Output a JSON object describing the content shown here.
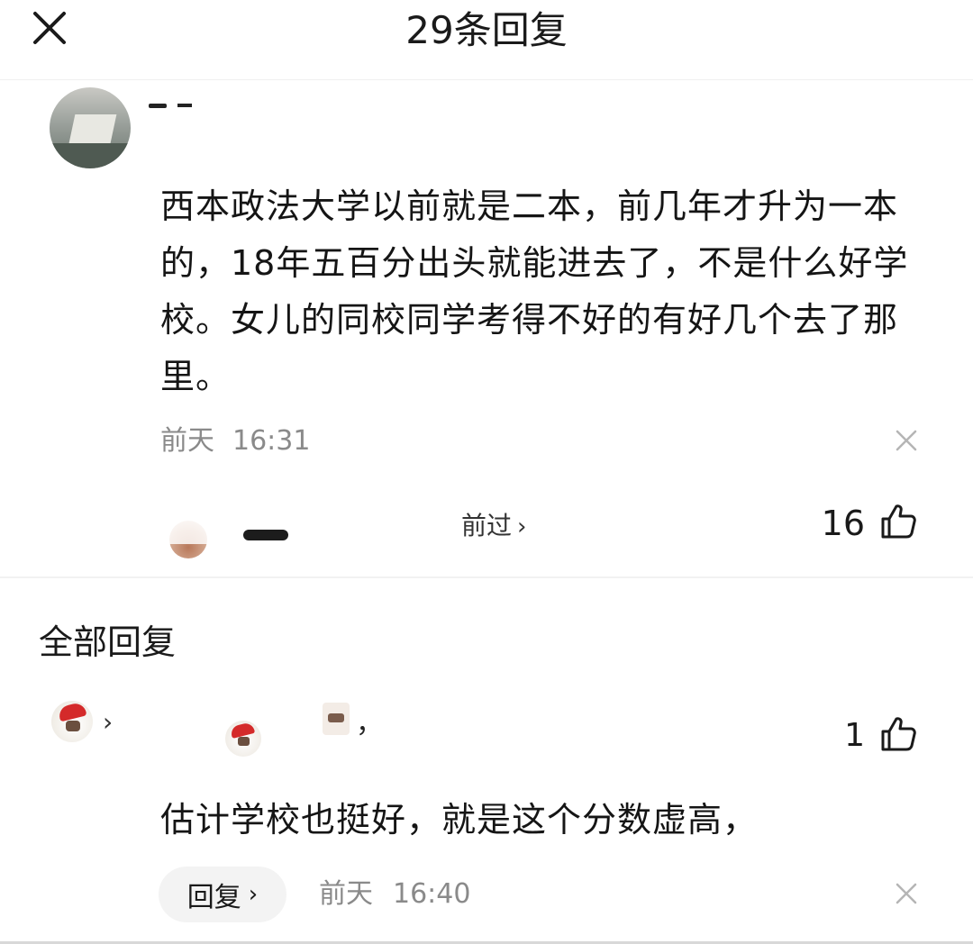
{
  "header": {
    "title": "29条回复",
    "close_icon": "close-icon"
  },
  "main_comment": {
    "text": "西本政法大学以前就是二本，前几年才升为一本的，18年五百分出头就能进去了，不是什么好学校。女儿的同校同学考得不好的有好几个去了那里。",
    "date": "前天",
    "time": "16:31",
    "view_link": "前过",
    "view_chevron": "›",
    "like_count": "16"
  },
  "section": {
    "title": "全部回复"
  },
  "reply": {
    "chevron": "›",
    "comma": "，",
    "like_count": "1",
    "text": "估计学校也挺好，就是这个分数虚高，",
    "reply_button": "回复",
    "reply_chevron": "›",
    "date": "前天",
    "time": "16:40"
  },
  "colors": {
    "text_primary": "#1a1a1a",
    "text_secondary": "#8a8a8a",
    "reply_button_bg": "#f3f3f3",
    "avatar_hat": "#d42a2a"
  },
  "icons": [
    "close-icon",
    "dismiss-icon",
    "thumbs-up-icon",
    "chevron-right-icon"
  ]
}
